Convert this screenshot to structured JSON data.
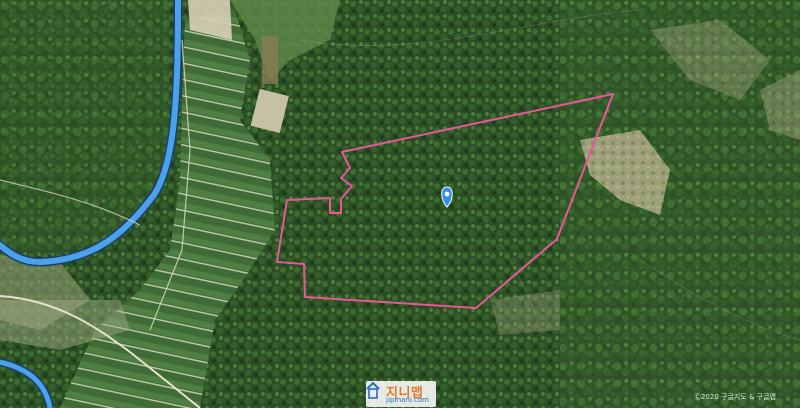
{
  "map": {
    "view": "satellite",
    "parcel_color": "#e8579a",
    "marker_color": "#2f8fe6",
    "road_color": "#4aa3e8",
    "edge_label": "",
    "credit": "Ⓒ2020 구글지도 & 구글맵",
    "logo": {
      "brand": "지니맵",
      "domain": "jipmani.com"
    }
  }
}
